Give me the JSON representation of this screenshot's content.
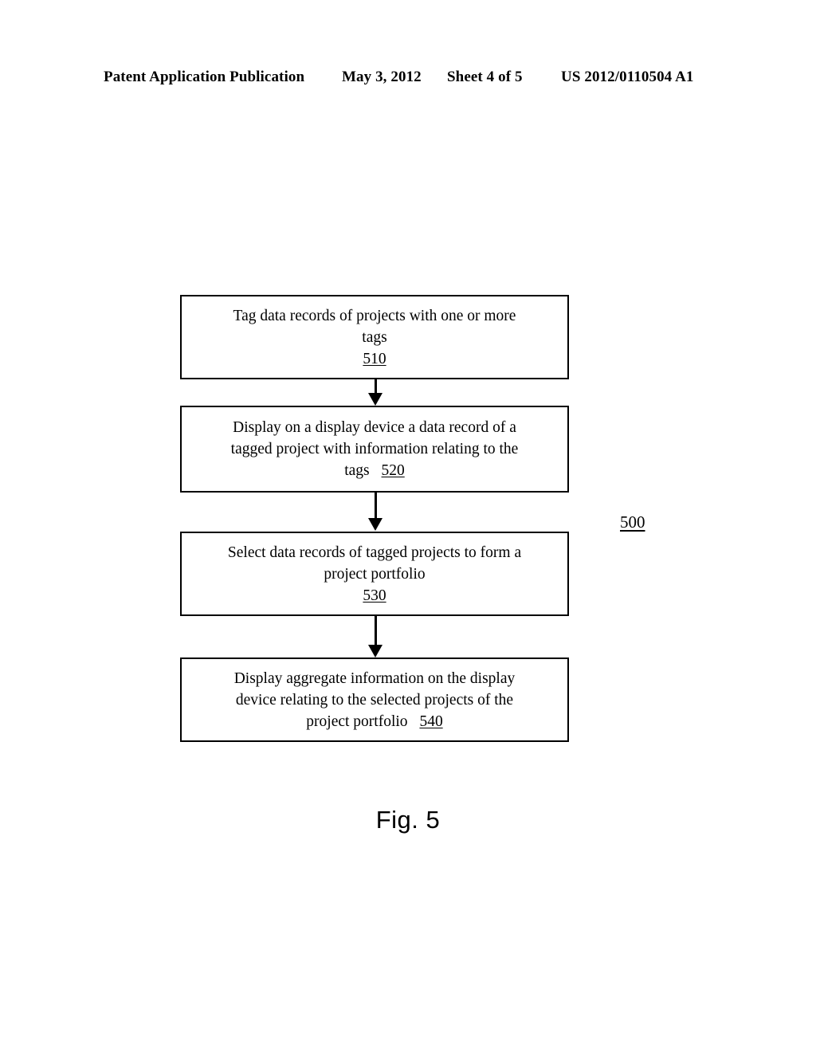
{
  "header": {
    "publication": "Patent Application Publication",
    "date": "May 3, 2012",
    "sheet": "Sheet 4 of 5",
    "patent_number": "US 2012/0110504 A1"
  },
  "figure": {
    "caption": "Fig. 5",
    "overall_reference": "500"
  },
  "flowchart": {
    "steps": [
      {
        "text": "Tag data records of projects with one or more\ntags\n",
        "reference": "510",
        "reference_inline": false
      },
      {
        "text": "Display on a display device a data record of a\ntagged project with information relating to the\ntags ",
        "reference": "520",
        "reference_inline": true
      },
      {
        "text": "Select data records of tagged projects to form a\nproject portfolio\n",
        "reference": "530",
        "reference_inline": false
      },
      {
        "text": "Display aggregate information on the display\ndevice relating to the selected projects of the\nproject portfolio ",
        "reference": "540",
        "reference_inline": true
      }
    ]
  }
}
